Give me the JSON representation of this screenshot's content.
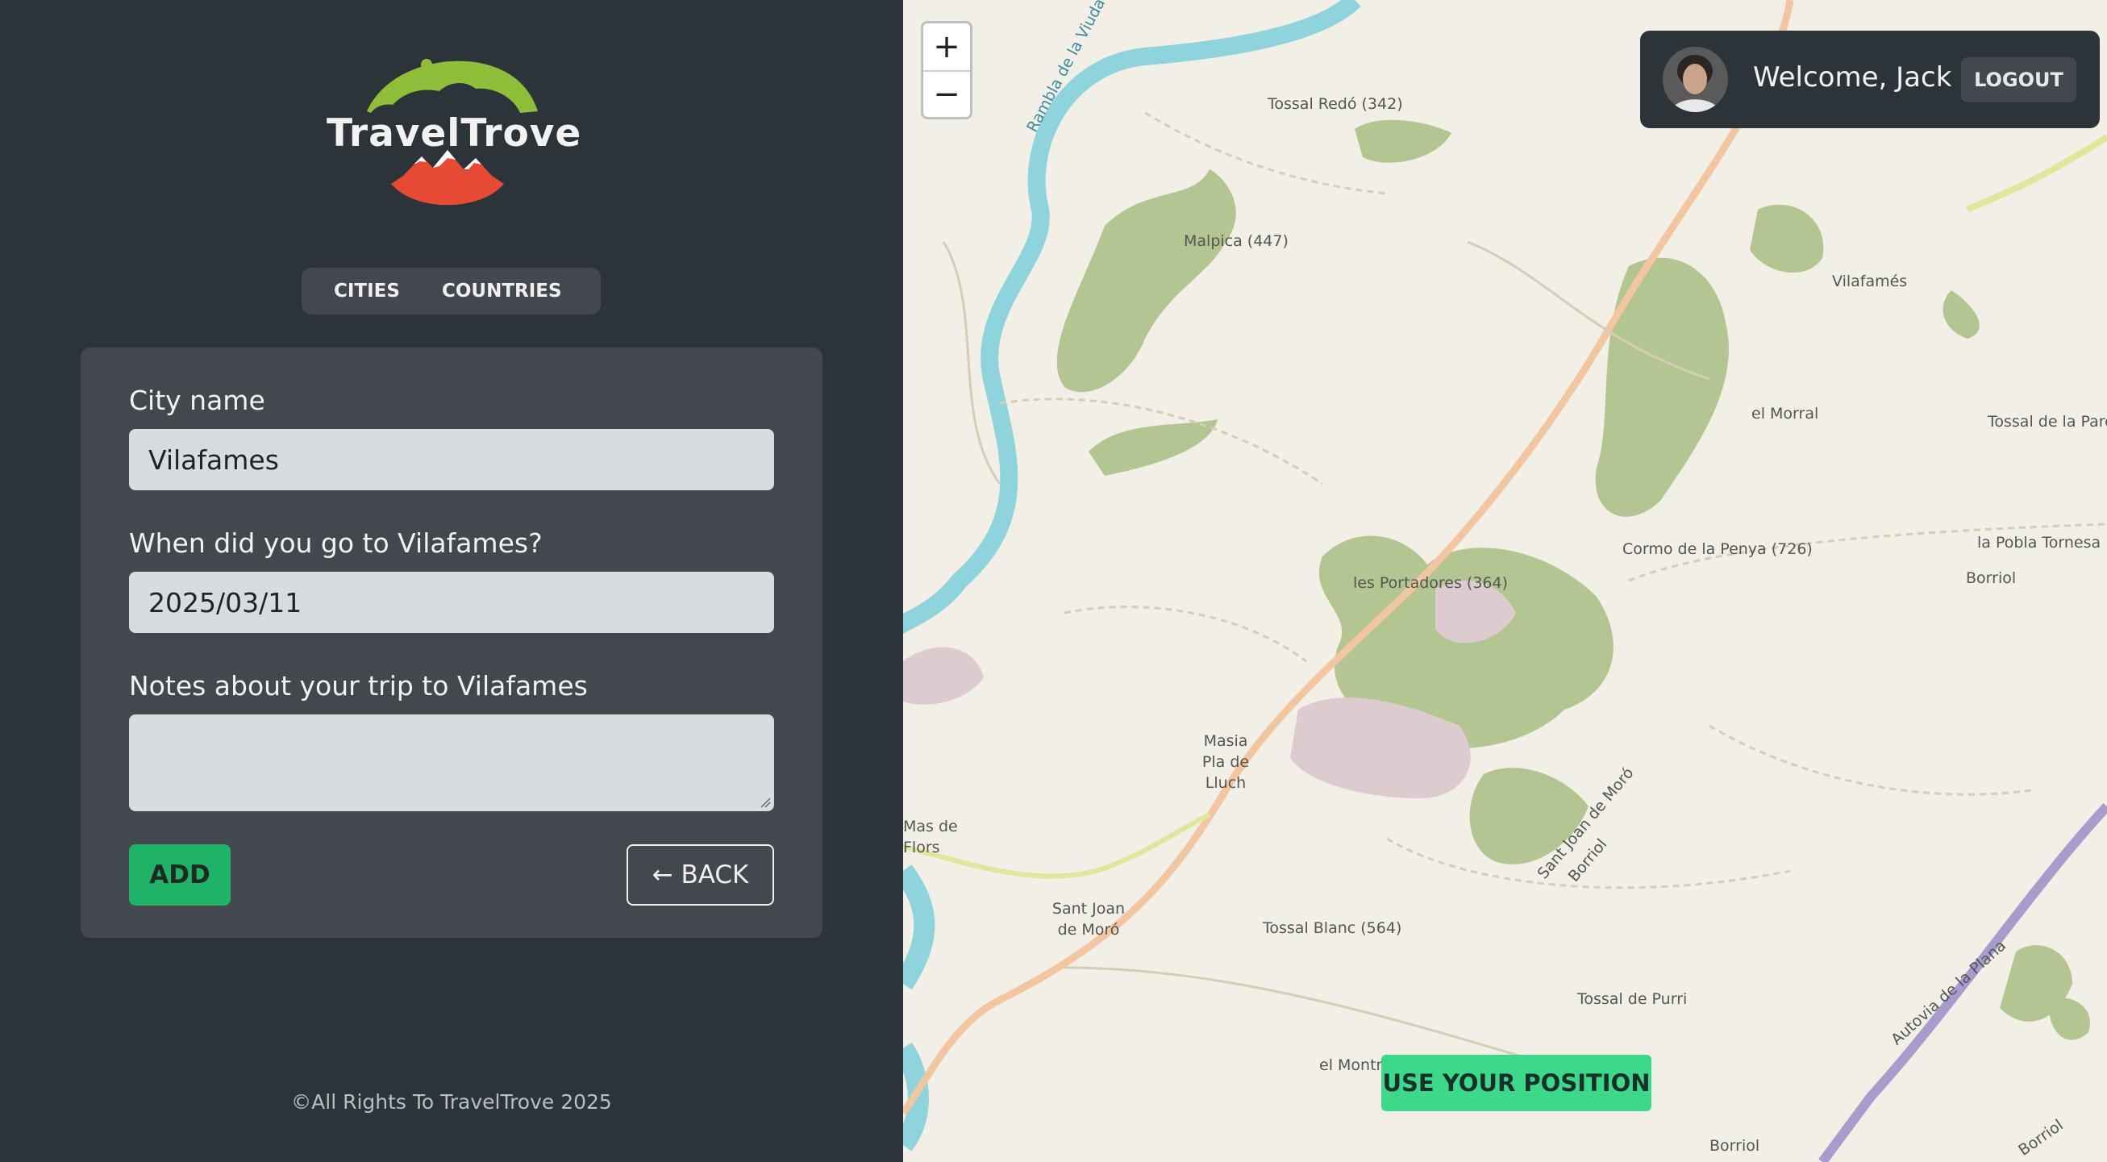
{
  "logo": {
    "text": "TravelTrove"
  },
  "nav": {
    "items": [
      {
        "label": "CITIES"
      },
      {
        "label": "COUNTRIES"
      }
    ]
  },
  "form": {
    "city_label": "City name",
    "city_value": "Vilafames",
    "date_label": "When did you go to Vilafames?",
    "date_value": "2025/03/11",
    "notes_label": "Notes about your trip to Vilafames",
    "notes_value": "",
    "add_label": "ADD",
    "back_label": "← BACK"
  },
  "footer": {
    "text": "©All Rights To TravelTrove 2025"
  },
  "map": {
    "zoom_in": "+",
    "zoom_out": "−",
    "user": {
      "welcome": "Welcome, Jack",
      "logout_label": "LOGOUT"
    },
    "position_button": "USE YOUR POSITION",
    "labels": [
      "Rambla de la Viuda",
      "Tossal Redó (342)",
      "Malpica (447)",
      "Vilafamés",
      "el Morral",
      "Tossal de la Parc",
      "Cormo de la Penya (726)",
      "la Pobla Tornesa",
      "Borriol",
      "les Portadores (364)",
      "Masia Pla de Lluch",
      "Mas de Flors",
      "Sant Joan de Moró",
      "Tossal Blanc (564)",
      "Tossal de Purri",
      "el Montnegro (504)",
      "Autovia de la Plana",
      "Sant Joan de Moró",
      "Borriol",
      "Borriol",
      "Borriol"
    ]
  },
  "colors": {
    "sidebar_bg": "#2d3439",
    "card_bg": "#42484e",
    "input_bg": "#d6dce0",
    "add_green": "#20b267",
    "position_green": "#3ed88a",
    "logo_green": "#8fbf3a",
    "logo_red": "#e64a34"
  }
}
